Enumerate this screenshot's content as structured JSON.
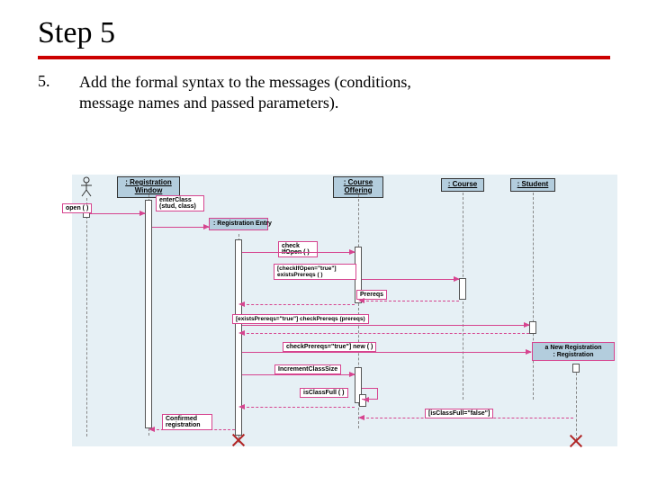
{
  "slide": {
    "title": "Step 5",
    "number": "5.",
    "description_line1": "Add the formal syntax to the messages (conditions,",
    "description_line2": "message names and passed parameters)."
  },
  "lifelines": {
    "actor": "",
    "regWindow": ": Registration Window",
    "regEntry": ": Registration Entry",
    "courseOffering": ": Course Offering",
    "course": ": Course",
    "student": ": Student",
    "newReg1": "a New Registration",
    "newReg2": ": Registration"
  },
  "messages": {
    "open": "open ( )",
    "enterClass": "enterClass (stud, class)",
    "checkIfOpen": "check IfOpen ( )",
    "existsPrereqs": "[checkIfOpen=\"true\"] existsPrereqs ( )",
    "prereqs": "Prereqs",
    "checkPrereqs": "[existsPrereqs=\"true\"] checkPrereqs (prereqs)",
    "new": "checkPrereqs=\"true\"] new ( )",
    "incrementClassSize": "IncrementClassSize",
    "isClassFull": "isClassFull ( )",
    "isClassFullFalse": "[isClassFull=\"false\"]",
    "confirmedReg": "Confirmed registration"
  }
}
